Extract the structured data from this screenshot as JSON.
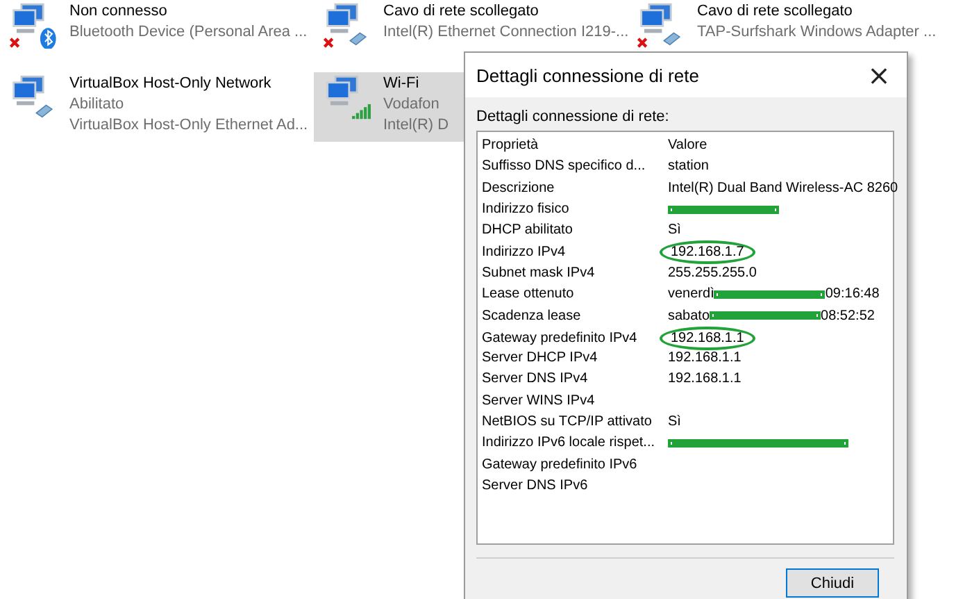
{
  "adapters": [
    {
      "name": "Non connesso",
      "status": "Bluetooth Device (Personal Area ...",
      "kind": "bluetooth",
      "disconnected": true,
      "selected": false
    },
    {
      "name": "Cavo di rete scollegato",
      "status": "Intel(R) Ethernet Connection I219-...",
      "kind": "ethernet",
      "disconnected": true,
      "selected": false
    },
    {
      "name": "Cavo di rete scollegato",
      "status": "TAP-Surfshark Windows Adapter ...",
      "kind": "ethernet",
      "disconnected": true,
      "selected": false
    },
    {
      "name": "VirtualBox Host-Only Network",
      "state": "Abilitato",
      "status": "VirtualBox Host-Only Ethernet Ad...",
      "kind": "ethernet",
      "disconnected": false,
      "selected": false
    },
    {
      "name": "Wi-Fi",
      "state": "Vodafon",
      "status": "Intel(R) D",
      "kind": "wifi",
      "disconnected": false,
      "selected": true
    }
  ],
  "dialog": {
    "title": "Dettagli connessione di rete",
    "close": "×",
    "label": "Dettagli connessione di rete:",
    "columns": [
      "Proprietà",
      "Valore"
    ],
    "rows": [
      {
        "property": "Suffisso DNS specifico d...",
        "value": "station"
      },
      {
        "property": "Descrizione",
        "value": "Intel(R) Dual Band Wireless-AC 8260"
      },
      {
        "property": "Indirizzo fisico",
        "redacted": true
      },
      {
        "property": "DHCP abilitato",
        "value": "Sì"
      },
      {
        "property": "Indirizzo IPv4",
        "value": "192.168.1.7",
        "circled": true
      },
      {
        "property": "Subnet mask IPv4",
        "value": "255.255.255.0"
      },
      {
        "property": "Lease ottenuto",
        "value": "venerdì",
        "redacted": true,
        "value_end": "09:16:48"
      },
      {
        "property": "Scadenza lease",
        "value": "sabato",
        "redacted": true,
        "value_end": "08:52:52"
      },
      {
        "property": "Gateway predefinito IPv4",
        "value": "192.168.1.1",
        "circled": true
      },
      {
        "property": "Server DHCP IPv4",
        "value": "192.168.1.1"
      },
      {
        "property": "Server DNS IPv4",
        "value": "192.168.1.1"
      },
      {
        "property": "Server WINS IPv4"
      },
      {
        "property": "NetBIOS su TCP/IP attivato",
        "value": "Sì"
      },
      {
        "property": "Indirizzo IPv6 locale rispet...",
        "redacted": true,
        "long_redaction": true
      },
      {
        "property": "Gateway predefinito IPv6"
      },
      {
        "property": "Server DNS IPv6"
      }
    ],
    "button": "Chiudi"
  }
}
